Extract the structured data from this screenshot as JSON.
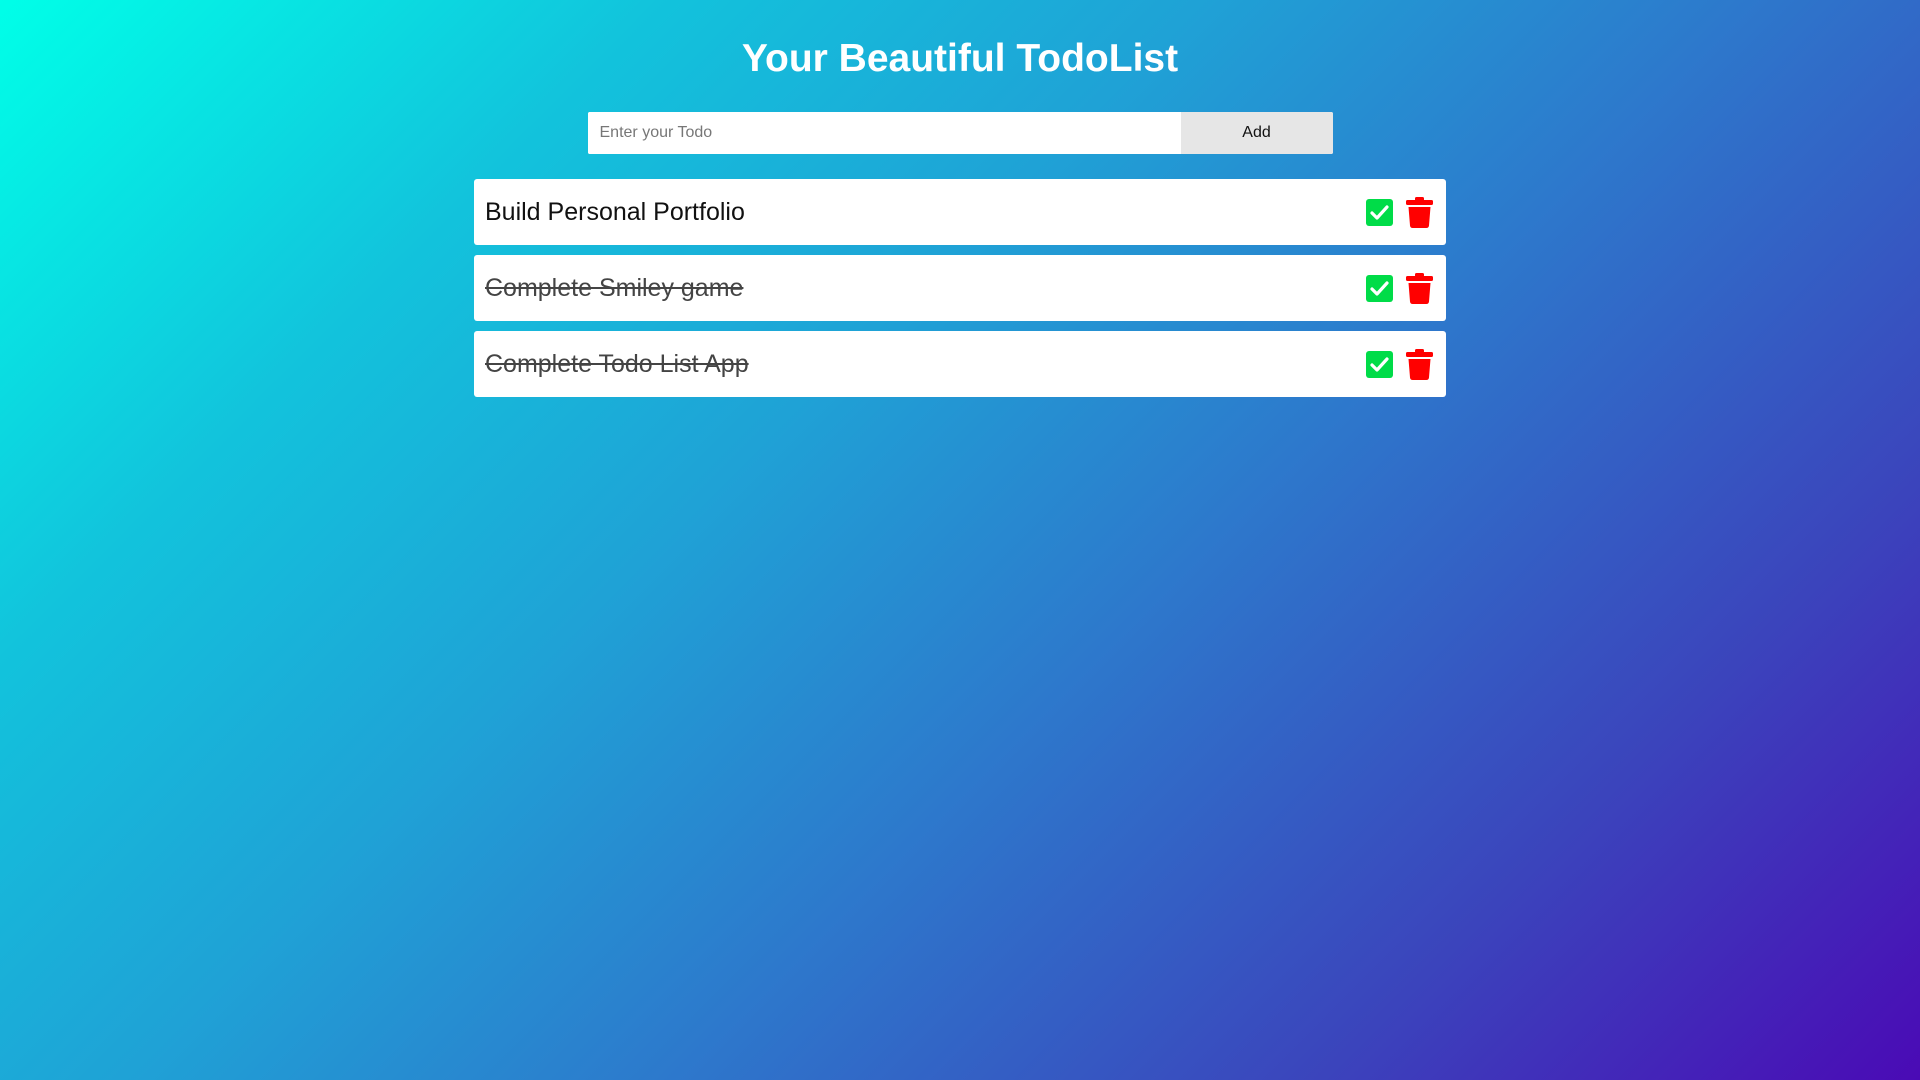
{
  "header": {
    "title": "Your Beautiful TodoList"
  },
  "form": {
    "placeholder": "Enter your Todo",
    "value": "",
    "add_label": "Add"
  },
  "todos": [
    {
      "text": "Build Personal Portfolio",
      "completed": false
    },
    {
      "text": "Complete Smiley game",
      "completed": true
    },
    {
      "text": "Complete Todo List App",
      "completed": true
    }
  ],
  "icons": {
    "complete": "check-square-icon",
    "delete": "trash-icon"
  },
  "colors": {
    "check": "#00dc48",
    "delete": "#ff0000",
    "gradient_start": "#00ffe8",
    "gradient_end": "#4a0ab5"
  }
}
